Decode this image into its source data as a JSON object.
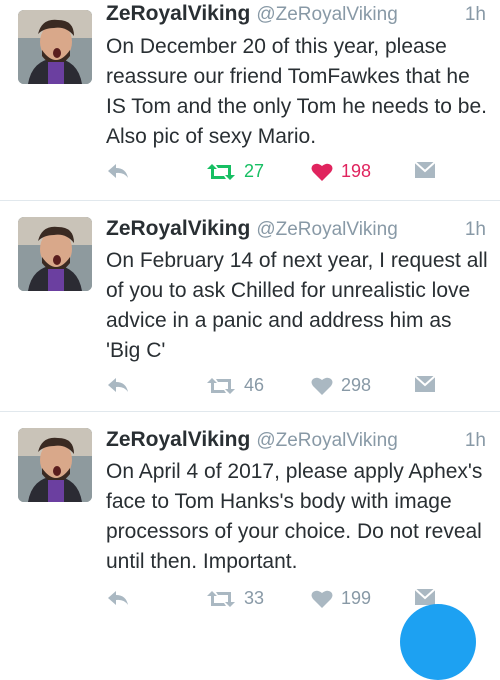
{
  "colors": {
    "retweet_active": "#17bf63",
    "like_active": "#e0245e",
    "inactive_icon": "#aab8c2",
    "fab": "#1da1f2"
  },
  "tweets": [
    {
      "name": "ZeRoyalViking",
      "handle": "@ZeRoyalViking",
      "time": "1h",
      "text": "On December 20 of this year, please reassure our friend TomFawkes that he IS Tom and the only Tom he needs to be. Also pic of sexy Mario.",
      "retweets": "27",
      "likes": "198",
      "retweeted": true,
      "liked": true
    },
    {
      "name": "ZeRoyalViking",
      "handle": "@ZeRoyalViking",
      "time": "1h",
      "text": "On February 14 of next year, I request all of you to ask Chilled for unrealistic love advice in a panic and address him as 'Big C'",
      "retweets": "46",
      "likes": "298",
      "retweeted": false,
      "liked": false
    },
    {
      "name": "ZeRoyalViking",
      "handle": "@ZeRoyalViking",
      "time": "1h",
      "text": "On April 4 of 2017, please apply Aphex's face to Tom Hanks's body with image processors of your choice. Do not reveal until then. Important.",
      "retweets": "33",
      "likes": "199",
      "retweeted": false,
      "liked": false
    }
  ]
}
